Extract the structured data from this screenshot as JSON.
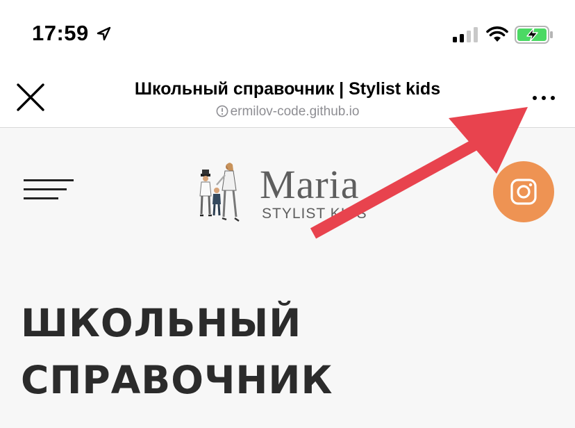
{
  "status_bar": {
    "time": "17:59",
    "icons": [
      "location-arrow-icon",
      "cellular-signal-icon",
      "wifi-icon",
      "battery-charging-icon"
    ],
    "battery_color": "#4cd964"
  },
  "browser": {
    "title": "Школьный справочник | Stylist kids",
    "url": "ermilov-code.github.io",
    "icons": [
      "close-icon",
      "info-icon",
      "more-icon"
    ]
  },
  "site": {
    "logo": {
      "name": "Maria",
      "subtitle": "STYLIST KIDS"
    },
    "instagram_color": "#ee9353",
    "hero_title_line1": "ШКОЛЬНЫЙ",
    "hero_title_line2": "СПРАВОЧНИК",
    "icons": [
      "menu-icon",
      "instagram-icon"
    ]
  },
  "annotation": {
    "arrow_color": "#e8434e"
  }
}
